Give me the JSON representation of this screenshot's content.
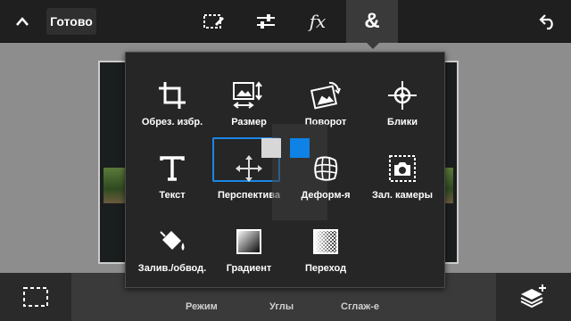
{
  "toolbar": {
    "done_label": "Готово",
    "fx_label": "fx",
    "amp_label": "&"
  },
  "panel": {
    "tools": [
      {
        "label": "Обрез. избр.",
        "icon": "crop-icon"
      },
      {
        "label": "Размер",
        "icon": "resize-icon"
      },
      {
        "label": "Поворот",
        "icon": "rotate-icon"
      },
      {
        "label": "Блики",
        "icon": "flare-icon"
      },
      {
        "label": "Текст",
        "icon": "text-icon"
      },
      {
        "label": "Перспектива",
        "icon": "move-arrows-icon",
        "selected": true
      },
      {
        "label": "Деформ-я",
        "icon": "warp-grid-icon"
      },
      {
        "label": "Зал. камеры",
        "icon": "camera-fill-icon"
      },
      {
        "label": "Залив./обвод.",
        "icon": "bucket-icon"
      },
      {
        "label": "Градиент",
        "icon": "gradient-icon"
      },
      {
        "label": "Переход",
        "icon": "transition-icon"
      }
    ],
    "swatches": {
      "gray": "#d7d7d7",
      "blue": "#0f82e6"
    }
  },
  "bottombar": {
    "items": [
      "Режим",
      "Углы",
      "Сглаж-е"
    ]
  },
  "colors": {
    "toolbar_bg": "#1f1f1f",
    "panel_bg": "#262626",
    "selection_accent": "#1b87e6"
  }
}
